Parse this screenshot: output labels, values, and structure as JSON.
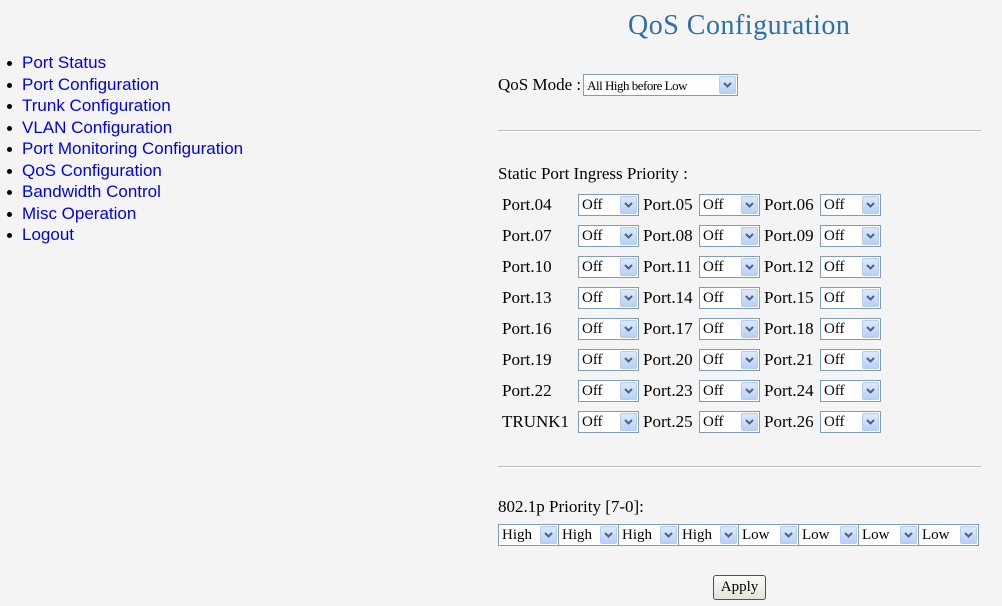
{
  "nav": {
    "items": [
      {
        "label": "Port Status"
      },
      {
        "label": "Port Configuration"
      },
      {
        "label": "Trunk Configuration"
      },
      {
        "label": "VLAN Configuration"
      },
      {
        "label": "Port Monitoring Configuration"
      },
      {
        "label": "QoS Configuration"
      },
      {
        "label": "Bandwidth Control"
      },
      {
        "label": "Misc Operation"
      },
      {
        "label": "Logout"
      }
    ]
  },
  "page": {
    "title": "QoS Configuration"
  },
  "qos_mode": {
    "label": "QoS Mode :",
    "value": "All High before Low"
  },
  "static_port": {
    "label": "Static Port Ingress Priority :",
    "rows": [
      [
        {
          "port": "Port.04",
          "value": "Off"
        },
        {
          "port": "Port.05",
          "value": "Off"
        },
        {
          "port": "Port.06",
          "value": "Off"
        }
      ],
      [
        {
          "port": "Port.07",
          "value": "Off"
        },
        {
          "port": "Port.08",
          "value": "Off"
        },
        {
          "port": "Port.09",
          "value": "Off"
        }
      ],
      [
        {
          "port": "Port.10",
          "value": "Off"
        },
        {
          "port": "Port.11",
          "value": "Off"
        },
        {
          "port": "Port.12",
          "value": "Off"
        }
      ],
      [
        {
          "port": "Port.13",
          "value": "Off"
        },
        {
          "port": "Port.14",
          "value": "Off"
        },
        {
          "port": "Port.15",
          "value": "Off"
        }
      ],
      [
        {
          "port": "Port.16",
          "value": "Off"
        },
        {
          "port": "Port.17",
          "value": "Off"
        },
        {
          "port": "Port.18",
          "value": "Off"
        }
      ],
      [
        {
          "port": "Port.19",
          "value": "Off"
        },
        {
          "port": "Port.20",
          "value": "Off"
        },
        {
          "port": "Port.21",
          "value": "Off"
        }
      ],
      [
        {
          "port": "Port.22",
          "value": "Off"
        },
        {
          "port": "Port.23",
          "value": "Off"
        },
        {
          "port": "Port.24",
          "value": "Off"
        }
      ],
      [
        {
          "port": "TRUNK1",
          "value": "Off"
        },
        {
          "port": "Port.25",
          "value": "Off"
        },
        {
          "port": "Port.26",
          "value": "Off"
        }
      ]
    ]
  },
  "dot1p": {
    "label": "802.1p Priority [7-0]:",
    "values": [
      "High",
      "High",
      "High",
      "High",
      "Low",
      "Low",
      "Low",
      "Low"
    ]
  },
  "apply_label": "Apply",
  "icons": {
    "dropdown": "chevron-down-icon",
    "bullet": "bullet-icon"
  },
  "colors": {
    "title": "#2e6fa6",
    "link": "#0000ee",
    "background": "#f4f4f4"
  }
}
